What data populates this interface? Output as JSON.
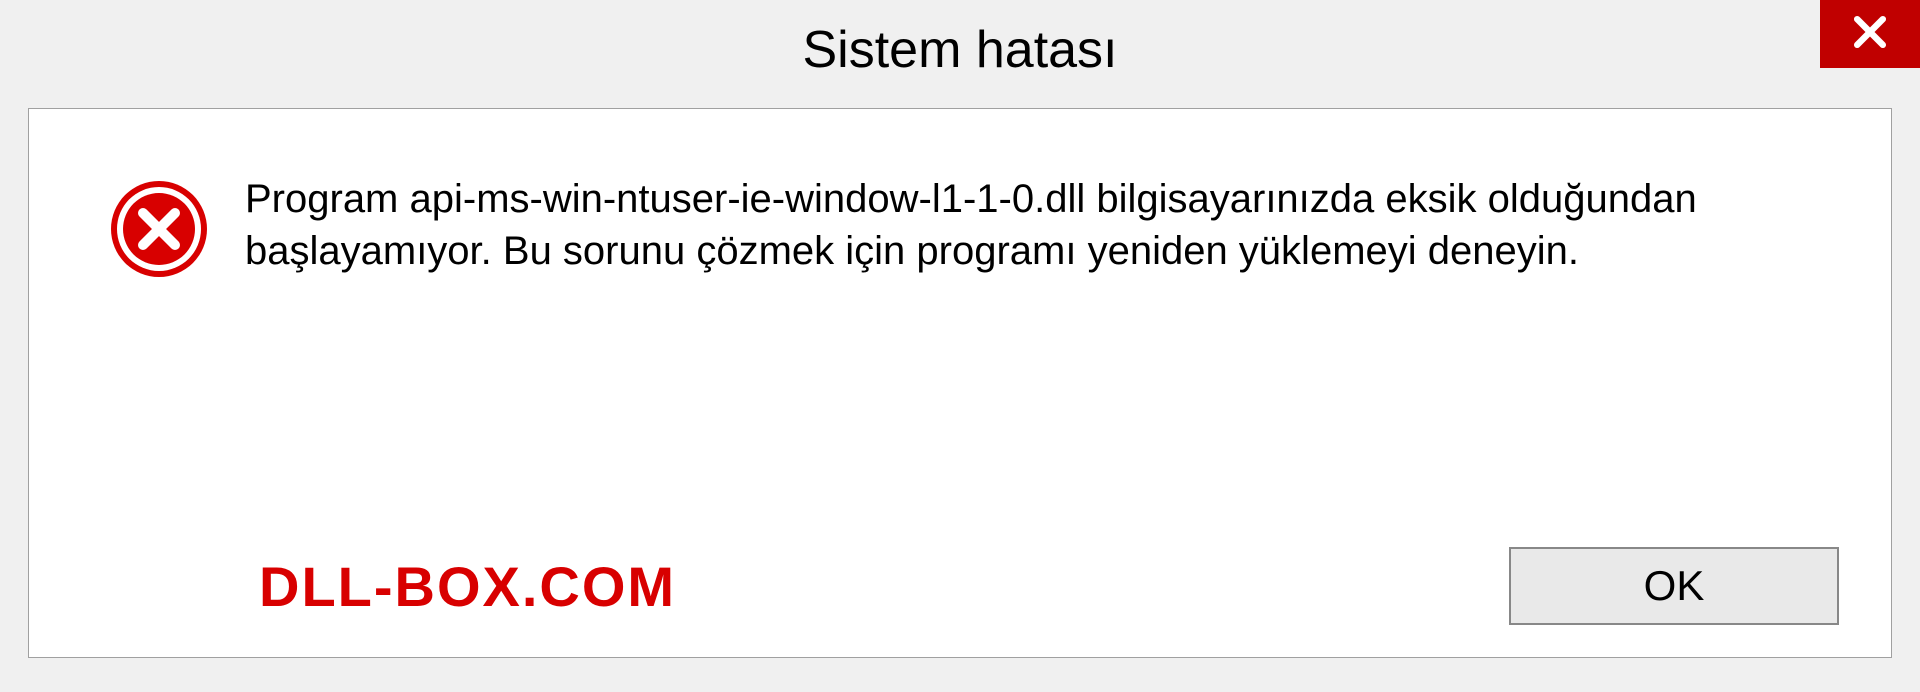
{
  "titlebar": {
    "title": "Sistem hatası"
  },
  "dialog": {
    "message": "Program api-ms-win-ntuser-ie-window-l1-1-0.dll bilgisayarınızda eksik olduğundan başlayamıyor. Bu sorunu çözmek için programı yeniden yüklemeyi deneyin.",
    "ok_label": "OK"
  },
  "watermark": {
    "text": "DLL-BOX.COM"
  },
  "icons": {
    "close": "close-icon",
    "error": "error-icon"
  },
  "colors": {
    "close_button_bg": "#c00000",
    "error_icon_bg": "#d80000",
    "watermark_color": "#d80000"
  }
}
